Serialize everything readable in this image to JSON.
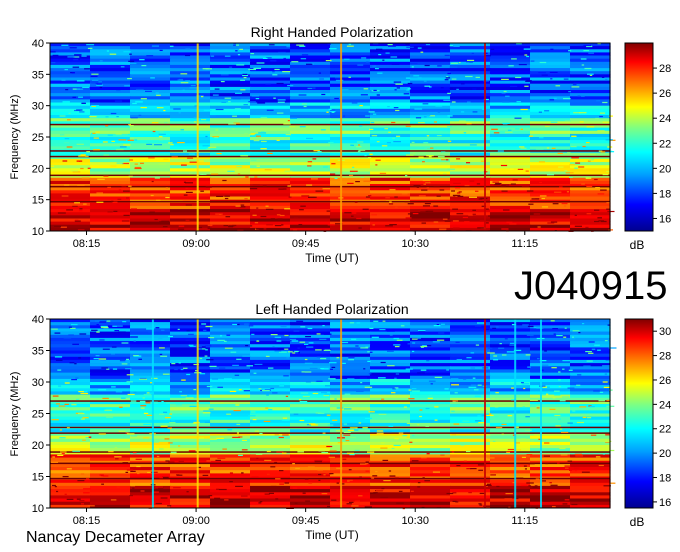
{
  "observation_id": "J040915",
  "credit": "Nancay Decameter Array",
  "chart_data": [
    {
      "type": "heatmap",
      "title": "Right Handed Polarization",
      "xlabel": "Time (UT)",
      "ylabel": "Frequency (MHz)",
      "x_ticks": [
        "08:15",
        "09:00",
        "09:45",
        "10:30",
        "11:15"
      ],
      "x_range_ut": [
        "08:00",
        "11:50"
      ],
      "y_ticks": [
        10,
        15,
        20,
        25,
        30,
        35,
        40
      ],
      "ylim": [
        10,
        40
      ],
      "colorbar": {
        "unit": "dB",
        "ticks": [
          16,
          18,
          20,
          22,
          24,
          26,
          28
        ],
        "range": [
          15,
          30
        ]
      },
      "colormap": [
        "#00008f",
        "#0000ff",
        "#00a0ff",
        "#00ffff",
        "#80ff80",
        "#ffff00",
        "#ff8000",
        "#ff0000",
        "#800000"
      ]
    },
    {
      "type": "heatmap",
      "title": "Left Handed Polarization",
      "xlabel": "Time (UT)",
      "ylabel": "Frequency (MHz)",
      "x_ticks": [
        "08:15",
        "09:00",
        "09:45",
        "10:30",
        "11:15"
      ],
      "x_range_ut": [
        "08:00",
        "11:50"
      ],
      "y_ticks": [
        10,
        15,
        20,
        25,
        30,
        35,
        40
      ],
      "ylim": [
        10,
        40
      ],
      "colorbar": {
        "unit": "dB",
        "ticks": [
          16,
          18,
          20,
          22,
          24,
          26,
          28,
          30
        ],
        "range": [
          15.5,
          31
        ]
      },
      "colormap": [
        "#00008f",
        "#0000ff",
        "#00a0ff",
        "#00ffff",
        "#80ff80",
        "#ffff00",
        "#ff8000",
        "#ff0000",
        "#800000"
      ]
    }
  ]
}
